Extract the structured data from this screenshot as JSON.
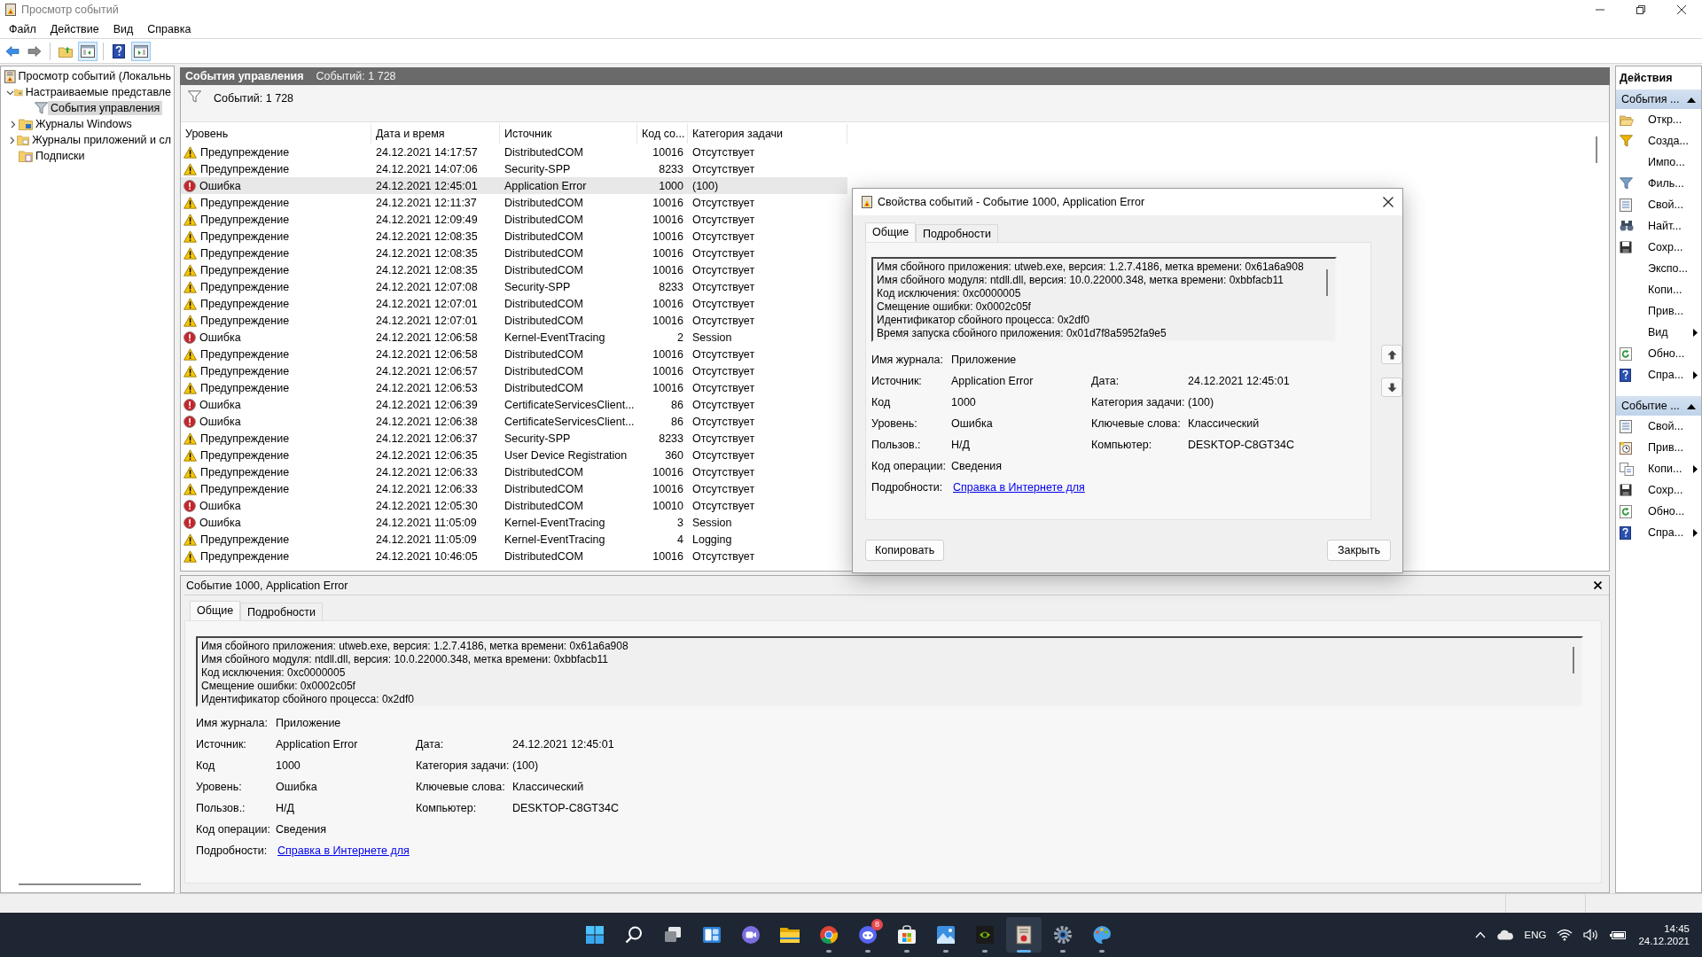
{
  "window": {
    "title": "Просмотр событий"
  },
  "menu": [
    "Файл",
    "Действие",
    "Вид",
    "Справка"
  ],
  "toolbar": [
    {
      "kind": "back",
      "pressed": false
    },
    {
      "kind": "forward",
      "pressed": false
    },
    {
      "kind": "up-folder",
      "pressed": false
    },
    {
      "kind": "console-tree",
      "pressed": true
    },
    {
      "kind": "help",
      "pressed": false
    },
    {
      "kind": "action-pane",
      "pressed": true
    }
  ],
  "tree": [
    {
      "kind": "viewer",
      "label": "Просмотр событий (Локальнь",
      "selected": false,
      "children": [
        {
          "kind": "folder",
          "label": "Настраиваемые представле",
          "expanded": true,
          "selected": false,
          "children": [
            {
              "kind": "filter",
              "label": "События управления",
              "selected": true
            }
          ]
        },
        {
          "kind": "folder-windows",
          "label": "Журналы Windows",
          "expanded": false,
          "selected": false
        },
        {
          "kind": "folder-apps",
          "label": "Журналы приложений и сл",
          "expanded": false,
          "selected": false
        },
        {
          "kind": "subscriptions",
          "label": "Подписки",
          "selected": false
        }
      ]
    }
  ],
  "view_header": {
    "title": "События управления",
    "count": "Событий: 1 728"
  },
  "filter_bar": {
    "count": "Событий: 1 728"
  },
  "table": {
    "columns": [
      "Уровень",
      "Дата и время",
      "Источник",
      "Код со...",
      "Категория задачи"
    ],
    "rows": [
      {
        "kind": "warning",
        "cells": [
          "Предупреждение",
          "24.12.2021 14:17:57",
          "DistributedCOM",
          "10016",
          "Отсутствует"
        ],
        "selected": false
      },
      {
        "kind": "warning",
        "cells": [
          "Предупреждение",
          "24.12.2021 14:07:06",
          "Security-SPP",
          "8233",
          "Отсутствует"
        ],
        "selected": false
      },
      {
        "kind": "error",
        "cells": [
          "Ошибка",
          "24.12.2021 12:45:01",
          "Application Error",
          "1000",
          "(100)"
        ],
        "selected": true
      },
      {
        "kind": "warning",
        "cells": [
          "Предупреждение",
          "24.12.2021 12:11:37",
          "DistributedCOM",
          "10016",
          "Отсутствует"
        ],
        "selected": false
      },
      {
        "kind": "warning",
        "cells": [
          "Предупреждение",
          "24.12.2021 12:09:49",
          "DistributedCOM",
          "10016",
          "Отсутствует"
        ],
        "selected": false
      },
      {
        "kind": "warning",
        "cells": [
          "Предупреждение",
          "24.12.2021 12:08:35",
          "DistributedCOM",
          "10016",
          "Отсутствует"
        ],
        "selected": false
      },
      {
        "kind": "warning",
        "cells": [
          "Предупреждение",
          "24.12.2021 12:08:35",
          "DistributedCOM",
          "10016",
          "Отсутствует"
        ],
        "selected": false
      },
      {
        "kind": "warning",
        "cells": [
          "Предупреждение",
          "24.12.2021 12:08:35",
          "DistributedCOM",
          "10016",
          "Отсутствует"
        ],
        "selected": false
      },
      {
        "kind": "warning",
        "cells": [
          "Предупреждение",
          "24.12.2021 12:07:08",
          "Security-SPP",
          "8233",
          "Отсутствует"
        ],
        "selected": false
      },
      {
        "kind": "warning",
        "cells": [
          "Предупреждение",
          "24.12.2021 12:07:01",
          "DistributedCOM",
          "10016",
          "Отсутствует"
        ],
        "selected": false
      },
      {
        "kind": "warning",
        "cells": [
          "Предупреждение",
          "24.12.2021 12:07:01",
          "DistributedCOM",
          "10016",
          "Отсутствует"
        ],
        "selected": false
      },
      {
        "kind": "error",
        "cells": [
          "Ошибка",
          "24.12.2021 12:06:58",
          "Kernel-EventTracing",
          "2",
          "Session"
        ],
        "selected": false
      },
      {
        "kind": "warning",
        "cells": [
          "Предупреждение",
          "24.12.2021 12:06:58",
          "DistributedCOM",
          "10016",
          "Отсутствует"
        ],
        "selected": false
      },
      {
        "kind": "warning",
        "cells": [
          "Предупреждение",
          "24.12.2021 12:06:57",
          "DistributedCOM",
          "10016",
          "Отсутствует"
        ],
        "selected": false
      },
      {
        "kind": "warning",
        "cells": [
          "Предупреждение",
          "24.12.2021 12:06:53",
          "DistributedCOM",
          "10016",
          "Отсутствует"
        ],
        "selected": false
      },
      {
        "kind": "error",
        "cells": [
          "Ошибка",
          "24.12.2021 12:06:39",
          "CertificateServicesClient...",
          "86",
          "Отсутствует"
        ],
        "selected": false
      },
      {
        "kind": "error",
        "cells": [
          "Ошибка",
          "24.12.2021 12:06:38",
          "CertificateServicesClient...",
          "86",
          "Отсутствует"
        ],
        "selected": false
      },
      {
        "kind": "warning",
        "cells": [
          "Предупреждение",
          "24.12.2021 12:06:37",
          "Security-SPP",
          "8233",
          "Отсутствует"
        ],
        "selected": false
      },
      {
        "kind": "warning",
        "cells": [
          "Предупреждение",
          "24.12.2021 12:06:35",
          "User Device Registration",
          "360",
          "Отсутствует"
        ],
        "selected": false
      },
      {
        "kind": "warning",
        "cells": [
          "Предупреждение",
          "24.12.2021 12:06:33",
          "DistributedCOM",
          "10016",
          "Отсутствует"
        ],
        "selected": false
      },
      {
        "kind": "warning",
        "cells": [
          "Предупреждение",
          "24.12.2021 12:06:33",
          "DistributedCOM",
          "10016",
          "Отсутствует"
        ],
        "selected": false
      },
      {
        "kind": "error",
        "cells": [
          "Ошибка",
          "24.12.2021 12:05:30",
          "DistributedCOM",
          "10010",
          "Отсутствует"
        ],
        "selected": false
      },
      {
        "kind": "error",
        "cells": [
          "Ошибка",
          "24.12.2021 11:05:09",
          "Kernel-EventTracing",
          "3",
          "Session"
        ],
        "selected": false
      },
      {
        "kind": "warning",
        "cells": [
          "Предупреждение",
          "24.12.2021 11:05:09",
          "Kernel-EventTracing",
          "4",
          "Logging"
        ],
        "selected": false
      },
      {
        "kind": "warning",
        "cells": [
          "Предупреждение",
          "24.12.2021 10:46:05",
          "DistributedCOM",
          "10016",
          "Отсутствует"
        ],
        "selected": false
      }
    ]
  },
  "detail_pane": {
    "title": "Событие 1000, Application Error",
    "tabs": [
      {
        "label": "Общие",
        "selected": true
      },
      {
        "label": "Подробности",
        "selected": false
      }
    ],
    "description": [
      "Имя сбойного приложения: utweb.exe, версия: 1.2.7.4186, метка времени: 0x61a6a908",
      "Имя сбойного модуля: ntdll.dll, версия: 10.0.22000.348, метка времени: 0xbbfacb11",
      "Код исключения: 0xc0000005",
      "Смещение ошибки: 0x0002c05f",
      "Идентификатор сбойного процесса: 0x2df0"
    ],
    "fields": [
      [
        {
          "kind": "text",
          "label": "Имя журнала:",
          "value": "Приложение"
        }
      ],
      [
        {
          "kind": "text",
          "label": "Источник:",
          "value": "Application Error"
        },
        {
          "kind": "text",
          "label": "Дата:",
          "value": "24.12.2021 12:45:01"
        }
      ],
      [
        {
          "kind": "text",
          "label": "Код",
          "value": "1000"
        },
        {
          "kind": "text",
          "label": "Категория задачи:",
          "value": "(100)"
        }
      ],
      [
        {
          "kind": "text",
          "label": "Уровень:",
          "value": "Ошибка"
        },
        {
          "kind": "text",
          "label": "Ключевые слова:",
          "value": "Классический"
        }
      ],
      [
        {
          "kind": "text",
          "label": "Пользов.:",
          "value": "Н/Д"
        },
        {
          "kind": "text",
          "label": "Компьютер:",
          "value": "DESKTOP-C8GT34C"
        }
      ],
      [
        {
          "kind": "text",
          "label": "Код операции:",
          "value": "Сведения"
        }
      ],
      [
        {
          "kind": "link",
          "label": "Подробности:",
          "value": "Справка в Интернете для"
        }
      ]
    ]
  },
  "dialog": {
    "title": "Свойства событий - Событие 1000, Application Error",
    "tabs": [
      {
        "label": "Общие",
        "selected": true
      },
      {
        "label": "Подробности",
        "selected": false
      }
    ],
    "description": [
      "Имя сбойного приложения: utweb.exe, версия: 1.2.7.4186, метка времени: 0x61a6a908",
      "Имя сбойного модуля: ntdll.dll, версия: 10.0.22000.348, метка времени: 0xbbfacb11",
      "Код исключения: 0xc0000005",
      "Смещение ошибки: 0x0002c05f",
      "Идентификатор сбойного процесса: 0x2df0",
      "Время запуска сбойного приложения: 0x01d7f8a5952fa9e5"
    ],
    "fields": [
      [
        {
          "kind": "text",
          "label": "Имя журнала:",
          "value": "Приложение"
        }
      ],
      [
        {
          "kind": "text",
          "label": "Источник:",
          "value": "Application Error"
        },
        {
          "kind": "text",
          "label": "Дата:",
          "value": "24.12.2021 12:45:01"
        }
      ],
      [
        {
          "kind": "text",
          "label": "Код",
          "value": "1000"
        },
        {
          "kind": "text",
          "label": "Категория задачи:",
          "value": "(100)"
        }
      ],
      [
        {
          "kind": "text",
          "label": "Уровень:",
          "value": "Ошибка"
        },
        {
          "kind": "text",
          "label": "Ключевые слова:",
          "value": "Классический"
        }
      ],
      [
        {
          "kind": "text",
          "label": "Пользов.:",
          "value": "Н/Д"
        },
        {
          "kind": "text",
          "label": "Компьютер:",
          "value": "DESKTOP-C8GT34C"
        }
      ],
      [
        {
          "kind": "text",
          "label": "Код операции:",
          "value": "Сведения"
        }
      ],
      [
        {
          "kind": "link",
          "label": "Подробности:",
          "value": "Справка в Интернете для"
        }
      ]
    ],
    "buttons": [
      "Копировать",
      "Закрыть"
    ]
  },
  "actions": {
    "title": "Действия",
    "sections": [
      {
        "title": "События ...",
        "expanded": true,
        "items": [
          {
            "kind": "open",
            "label": "Откр...",
            "submenu": false
          },
          {
            "kind": "create-filter",
            "label": "Созда...",
            "submenu": false
          },
          {
            "kind": "none",
            "label": "Импо...",
            "submenu": false
          },
          {
            "kind": "filter",
            "label": "Филь...",
            "submenu": false
          },
          {
            "kind": "properties",
            "label": "Свой...",
            "submenu": false
          },
          {
            "kind": "find",
            "label": "Найт...",
            "submenu": false
          },
          {
            "kind": "save",
            "label": "Сохр...",
            "submenu": false
          },
          {
            "kind": "none",
            "label": "Экспо...",
            "submenu": false
          },
          {
            "kind": "none",
            "label": "Копи...",
            "submenu": false
          },
          {
            "kind": "none",
            "label": "Прив...",
            "submenu": false
          },
          {
            "kind": "none",
            "label": "Вид",
            "submenu": true
          },
          {
            "kind": "refresh",
            "label": "Обно...",
            "submenu": false
          },
          {
            "kind": "help",
            "label": "Спра...",
            "submenu": true
          }
        ]
      },
      {
        "title": "Событие ...",
        "expanded": true,
        "items": [
          {
            "kind": "properties",
            "label": "Свой...",
            "submenu": false
          },
          {
            "kind": "attach-task",
            "label": "Прив...",
            "submenu": false
          },
          {
            "kind": "copy",
            "label": "Копи...",
            "submenu": true
          },
          {
            "kind": "save",
            "label": "Сохр...",
            "submenu": false
          },
          {
            "kind": "refresh",
            "label": "Обно...",
            "submenu": false
          },
          {
            "kind": "help",
            "label": "Спра...",
            "submenu": true
          }
        ]
      }
    ]
  },
  "taskbar": {
    "apps": [
      {
        "kind": "start",
        "running": false,
        "selected": false
      },
      {
        "kind": "search",
        "running": false,
        "selected": false
      },
      {
        "kind": "task-view",
        "running": false,
        "selected": false
      },
      {
        "kind": "widgets",
        "running": false,
        "selected": false
      },
      {
        "kind": "chat",
        "running": false,
        "selected": false
      },
      {
        "kind": "explorer",
        "running": false,
        "selected": false
      },
      {
        "kind": "browser",
        "running": true,
        "selected": false
      },
      {
        "kind": "discord",
        "running": true,
        "selected": false,
        "badge": "8"
      },
      {
        "kind": "store",
        "running": true,
        "selected": false
      },
      {
        "kind": "photos",
        "running": true,
        "selected": false
      },
      {
        "kind": "nvidia",
        "running": true,
        "selected": false
      },
      {
        "kind": "event-viewer",
        "running": true,
        "selected": true
      },
      {
        "kind": "settings",
        "running": true,
        "selected": false
      },
      {
        "kind": "paint",
        "running": true,
        "selected": false
      }
    ],
    "language": "ENG",
    "time": "14:45",
    "date": "24.12.2021"
  }
}
